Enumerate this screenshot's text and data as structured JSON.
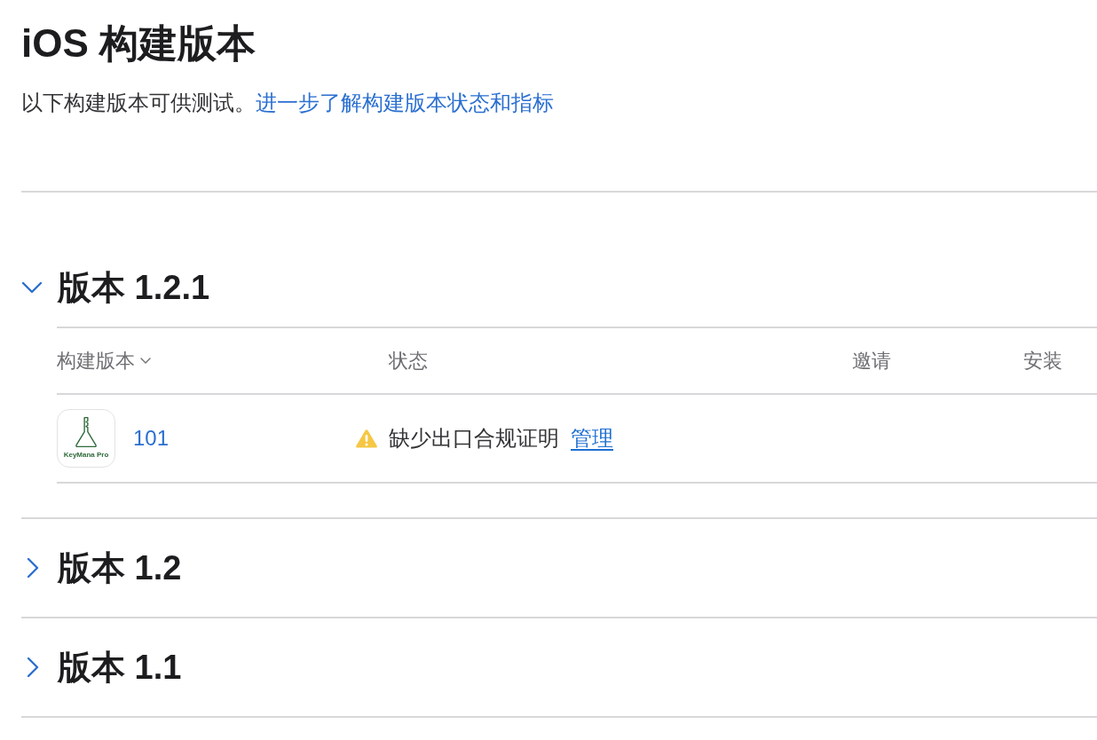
{
  "page": {
    "title": "iOS 构建版本",
    "description": "以下构建版本可供测试。",
    "description_link": "进一步了解构建版本状态和指标"
  },
  "versions": [
    {
      "title": "版本 1.2.1",
      "expanded": true,
      "table": {
        "columns": [
          {
            "label": "构建版本",
            "sorted": true
          },
          {
            "label": "状态",
            "sorted": false
          },
          {
            "label": "邀请",
            "sorted": false
          },
          {
            "label": "安装",
            "sorted": false
          }
        ],
        "rows": [
          {
            "app_logo_text": "KeyMana Pro",
            "build": "101",
            "status": {
              "kind": "warning",
              "text": "缺少出口合规证明",
              "action": "管理"
            }
          }
        ]
      }
    },
    {
      "title": "版本 1.2",
      "expanded": false
    },
    {
      "title": "版本 1.1",
      "expanded": false
    }
  ]
}
